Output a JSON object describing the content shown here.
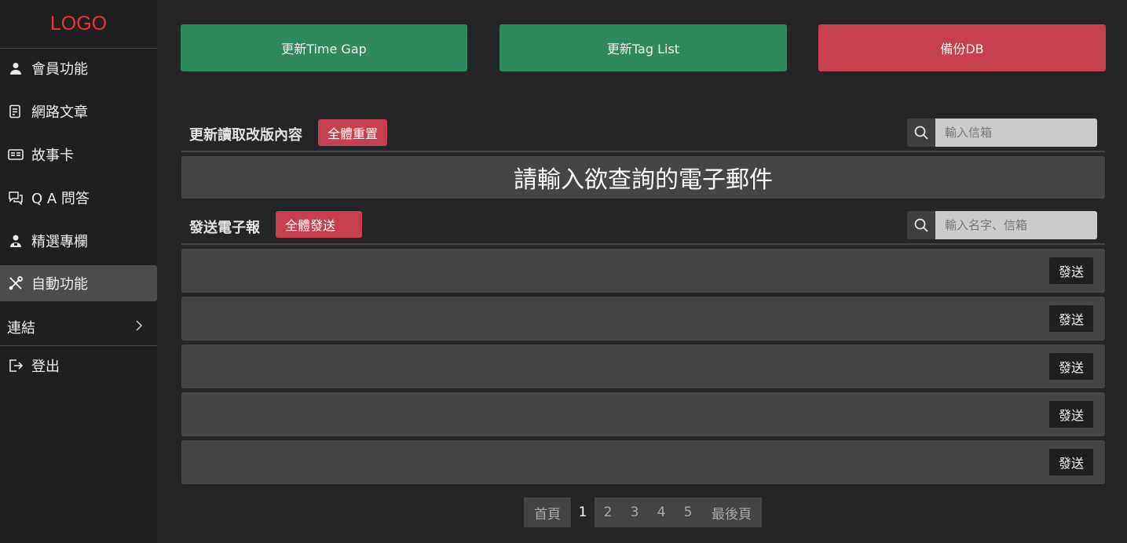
{
  "sidebar": {
    "logo": "LOGO",
    "items": [
      {
        "label": "會員功能"
      },
      {
        "label": "網路文章"
      },
      {
        "label": "故事卡"
      },
      {
        "label": "Q A 問答"
      },
      {
        "label": "精選專欄"
      },
      {
        "label": "自動功能"
      },
      {
        "label": "連結"
      },
      {
        "label": "登出"
      }
    ]
  },
  "actions": {
    "time_gap": "更新Time Gap",
    "tag_list": "更新Tag List",
    "backup_db": "備份DB"
  },
  "reset_section": {
    "title": "更新讀取改版內容",
    "reset_all": "全體重置",
    "search_placeholder": "輸入信箱",
    "message": "請輸入欲查詢的電子郵件"
  },
  "newsletter": {
    "title": "發送電子報",
    "send_all": "全體發送",
    "search_placeholder": "輸入名字、信箱",
    "rows": [
      {
        "send_label": "發送"
      },
      {
        "send_label": "發送"
      },
      {
        "send_label": "發送"
      },
      {
        "send_label": "發送"
      },
      {
        "send_label": "發送"
      }
    ]
  },
  "pagination": {
    "first": "首頁",
    "pages": [
      "1",
      "2",
      "3",
      "4",
      "5"
    ],
    "current": "1",
    "last": "最後頁"
  },
  "colors": {
    "accent_green": "#2e8a5c",
    "accent_red": "#c7404f",
    "logo_red": "#e8352c"
  }
}
